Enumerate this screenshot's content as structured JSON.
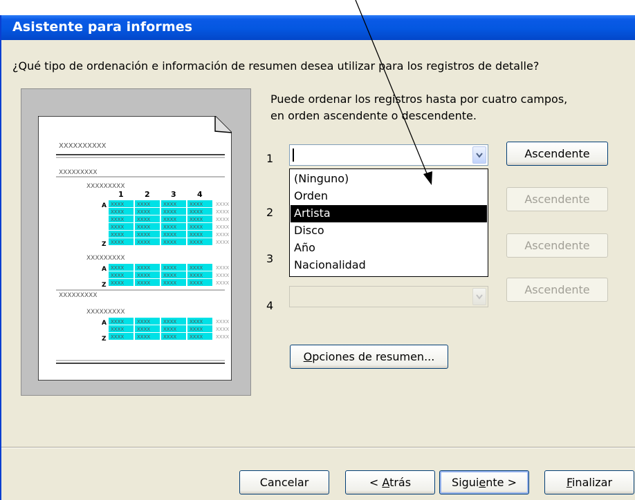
{
  "window": {
    "title": "Asistente para informes"
  },
  "question": "¿Qué tipo de ordenación e información de resumen desea utilizar para los registros de detalle?",
  "description": [
    "Puede ordenar los registros hasta por cuatro campos,",
    "en orden ascendente o descendente."
  ],
  "sort_levels": [
    {
      "number": "1",
      "value": "",
      "order_button": "Ascendente",
      "enabled": true
    },
    {
      "number": "2",
      "value": "",
      "order_button": "Ascendente",
      "enabled": false
    },
    {
      "number": "3",
      "value": "",
      "order_button": "Ascendente",
      "enabled": false
    },
    {
      "number": "4",
      "value": "",
      "order_button": "Ascendente",
      "enabled": false
    }
  ],
  "dropdown": {
    "options": [
      "(Ninguno)",
      "Orden",
      "Artista",
      "Disco",
      "Año",
      "Nacionalidad"
    ],
    "highlighted": "Artista"
  },
  "preview": {
    "placeholder": "XXXXXXXXXX",
    "placeholder_short": "XXXXXXXXX",
    "cell": "XXXX",
    "column_numbers": [
      "1",
      "2",
      "3",
      "4"
    ],
    "sort_top": "A",
    "sort_bottom": "Z"
  },
  "summary_button": {
    "label_pre": "",
    "label_key": "O",
    "label_post": "pciones de resumen..."
  },
  "footer": {
    "cancel": "Cancelar",
    "back_pre": "< ",
    "back_key": "A",
    "back_post": "trás",
    "next_pre": "Sigui",
    "next_key": "e",
    "next_post": "nte >",
    "finish_pre": "",
    "finish_key": "F",
    "finish_post": "inalizar"
  },
  "colors": {
    "title_bar": "#0458e2",
    "dialog_bg": "#ece9d8",
    "highlight": "#000000",
    "preview_cell": "#00e1e6"
  }
}
